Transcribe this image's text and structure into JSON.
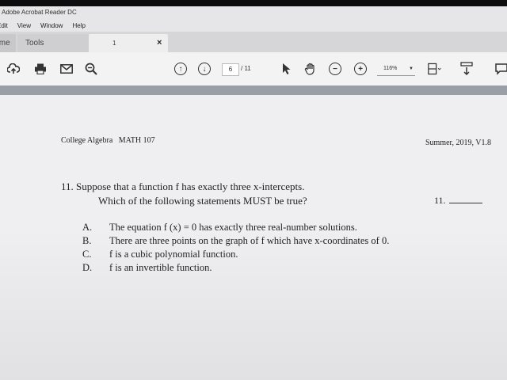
{
  "window": {
    "title": "Adobe Acrobat Reader DC"
  },
  "menubar": {
    "items": [
      "Edit",
      "View",
      "Window",
      "Help"
    ]
  },
  "tabs": {
    "home": "Home",
    "tools": "Tools",
    "document": "1"
  },
  "toolbar": {
    "page_current": "6",
    "page_total": "/ 11",
    "zoom": "116%"
  },
  "document": {
    "header_left": "College Algebra   MATH 107",
    "header_right": "Summer, 2019, V1.8",
    "question_line1": "11. Suppose that a function f has exactly three x-intercepts.",
    "question_line2": "Which of the following statements MUST be true?",
    "answer_label": "11.",
    "options": [
      {
        "letter": "A.",
        "text": "The equation f (x) = 0 has exactly three real-number solutions."
      },
      {
        "letter": "B.",
        "text": "There are three points on the graph of f which have x-coordinates of 0."
      },
      {
        "letter": "C.",
        "text": "f is a cubic polynomial function."
      },
      {
        "letter": "D.",
        "text": "f is an invertible function."
      }
    ]
  }
}
